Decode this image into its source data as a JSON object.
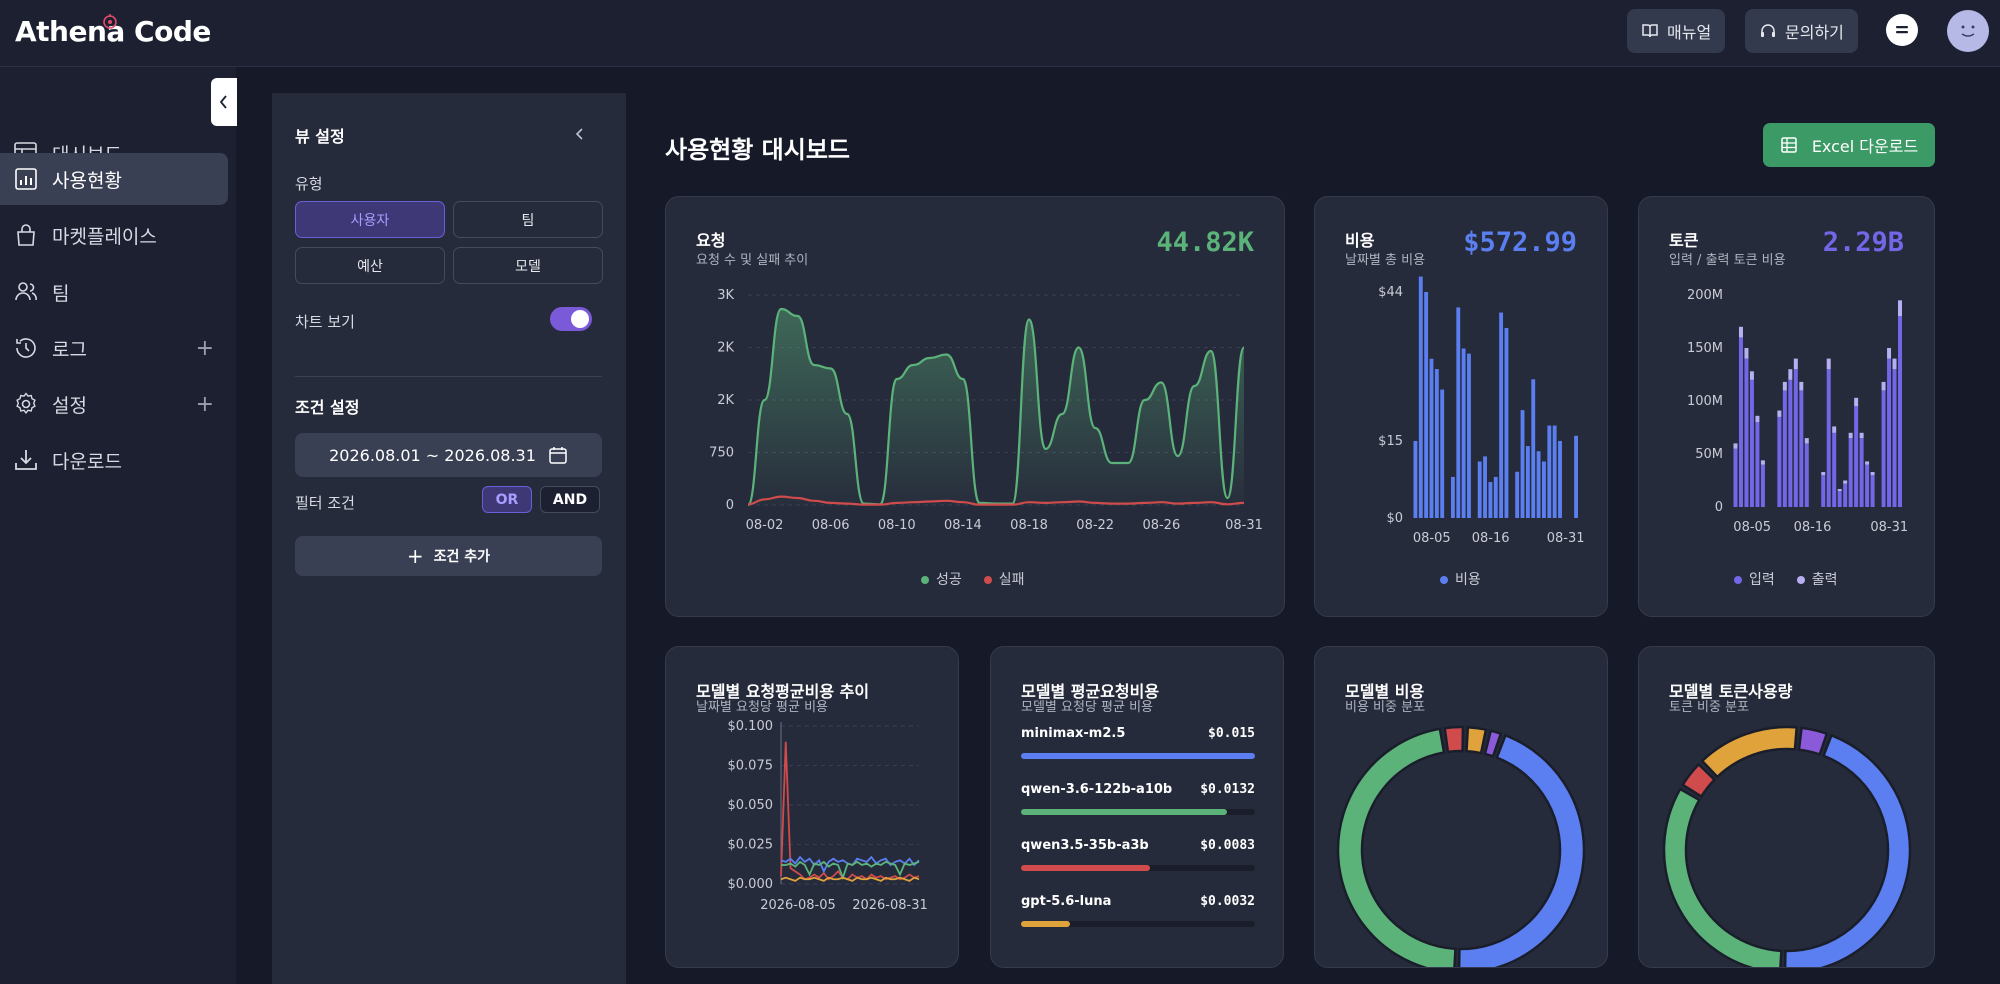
{
  "app": {
    "title": "Athena Code"
  },
  "header": {
    "manual_label": "매뉴얼",
    "contact_label": "문의하기"
  },
  "sidebar": {
    "items": [
      {
        "label": "대시보드",
        "icon": "table-icon"
      },
      {
        "label": "사용현황",
        "icon": "bar-chart-icon",
        "active": true
      },
      {
        "label": "마켓플레이스",
        "icon": "bag-icon"
      },
      {
        "label": "팀",
        "icon": "users-icon"
      },
      {
        "label": "로그",
        "icon": "history-icon",
        "expandable": true
      },
      {
        "label": "설정",
        "icon": "gear-icon",
        "expandable": true
      },
      {
        "label": "다운로드",
        "icon": "download-icon"
      }
    ]
  },
  "view_panel": {
    "title": "뷰 설정",
    "type_label": "유형",
    "type_options": [
      "사용자",
      "팀",
      "예산",
      "모델"
    ],
    "type_selected": "사용자",
    "chart_view_label": "차트 보기",
    "chart_view_on": true,
    "condition_title": "조건 설정",
    "date_range": "2026.08.01 ~ 2026.08.31",
    "filter_label": "필터 조건",
    "filter_or": "OR",
    "filter_and": "AND",
    "filter_selected": "OR",
    "add_condition_label": "조건 추가"
  },
  "main": {
    "title": "사용현황 대시보드",
    "excel_label": "Excel 다운로드"
  },
  "cards": {
    "requests": {
      "title": "요청",
      "subtitle": "요청 수 및 실패 추이",
      "total": "44.82K",
      "legend": [
        "성공",
        "실패"
      ]
    },
    "cost": {
      "title": "비용",
      "subtitle": "날짜별 총 비용",
      "total": "$572.99",
      "legend": [
        "비용"
      ]
    },
    "tokens": {
      "title": "토큰",
      "subtitle": "입력 / 출력 토큰 비용",
      "total": "2.29B",
      "legend": [
        "입력",
        "출력"
      ]
    },
    "model_trend": {
      "title": "모델별 요청평균비용 추이",
      "subtitle": "날짜별 요청당 평균 비용"
    },
    "model_avg": {
      "title": "모델별 평균요청비용",
      "subtitle": "모델별 요청당 평균 비용",
      "rows": [
        {
          "name": "minimax-m2.5",
          "value": "$0.015",
          "ratio": 1.0,
          "color": "#5b7ff0"
        },
        {
          "name": "qwen-3.6-122b-a10b",
          "value": "$0.0132",
          "ratio": 0.88,
          "color": "#5cb37a"
        },
        {
          "name": "qwen3.5-35b-a3b",
          "value": "$0.0083",
          "ratio": 0.55,
          "color": "#d04b4b"
        },
        {
          "name": "gpt-5.6-luna",
          "value": "$0.0032",
          "ratio": 0.21,
          "color": "#e0a23a"
        }
      ]
    },
    "model_cost": {
      "title": "모델별 비용",
      "subtitle": "비용 비중 분포"
    },
    "model_tokens": {
      "title": "모델별 토큰사용량",
      "subtitle": "토큰 비중 분포"
    }
  },
  "colors": {
    "accent": "#7a5ad8",
    "success": "#5cb37a",
    "fail": "#d04b4b",
    "blue": "#5b7ff0",
    "violet": "#7367e8",
    "orange": "#e0a23a",
    "excel": "#3c9a66"
  },
  "chart_data": [
    {
      "type": "area",
      "title": "요청",
      "x_ticks": [
        "08-02",
        "08-06",
        "08-10",
        "08-14",
        "08-18",
        "08-22",
        "08-26",
        "08-31"
      ],
      "y_ticks": [
        "0",
        "750",
        "2K",
        "2K",
        "3K"
      ],
      "ylim": [
        0,
        3000
      ],
      "x": [
        1,
        2,
        3,
        4,
        5,
        6,
        7,
        8,
        9,
        10,
        11,
        12,
        13,
        14,
        15,
        16,
        17,
        18,
        19,
        20,
        21,
        22,
        23,
        24,
        25,
        26,
        27,
        28,
        29,
        30,
        31
      ],
      "series": [
        {
          "name": "성공",
          "values": [
            0,
            1500,
            2800,
            2700,
            2000,
            1950,
            1300,
            20,
            10,
            1800,
            2000,
            2100,
            2150,
            1800,
            30,
            20,
            20,
            2650,
            800,
            1300,
            2250,
            1100,
            600,
            600,
            1500,
            1750,
            700,
            1700,
            2200,
            100,
            2250
          ]
        },
        {
          "name": "실패",
          "values": [
            10,
            80,
            120,
            100,
            60,
            30,
            20,
            5,
            5,
            30,
            40,
            50,
            60,
            40,
            5,
            5,
            5,
            40,
            30,
            40,
            50,
            30,
            20,
            20,
            30,
            40,
            20,
            30,
            40,
            10,
            30
          ]
        }
      ]
    },
    {
      "type": "bar",
      "title": "비용",
      "x_ticks": [
        "08-05",
        "08-16",
        "08-31"
      ],
      "y_ticks": [
        "$0",
        "$15",
        "$44"
      ],
      "ylim": [
        0,
        44
      ],
      "series": [
        {
          "name": "비용",
          "values": [
            15,
            47,
            44,
            31,
            29,
            25,
            0,
            8,
            41,
            33,
            32,
            0,
            11,
            12,
            7,
            8,
            40,
            37,
            0,
            9,
            21,
            14,
            27,
            13,
            11,
            18,
            18,
            15,
            0,
            0,
            16
          ]
        }
      ]
    },
    {
      "type": "bar",
      "title": "토큰",
      "x_ticks": [
        "08-05",
        "08-16",
        "08-31"
      ],
      "y_ticks": [
        "0",
        "50M",
        "100M",
        "150M",
        "200M"
      ],
      "ylim": [
        0,
        200
      ],
      "series": [
        {
          "name": "입력",
          "values": [
            55,
            160,
            140,
            120,
            80,
            40,
            0,
            0,
            85,
            110,
            120,
            130,
            110,
            60,
            0,
            0,
            30,
            130,
            70,
            15,
            22,
            65,
            95,
            65,
            40,
            30,
            0,
            110,
            140,
            130,
            180
          ]
        },
        {
          "name": "출력",
          "values": [
            5,
            10,
            10,
            8,
            6,
            4,
            0,
            0,
            6,
            8,
            10,
            10,
            8,
            5,
            0,
            0,
            3,
            10,
            6,
            2,
            3,
            5,
            8,
            5,
            3,
            3,
            0,
            8,
            10,
            10,
            15
          ]
        }
      ]
    },
    {
      "type": "line",
      "title": "모델별 요청평균비용 추이",
      "x_ticks": [
        "2026-08-05",
        "2026-08-31"
      ],
      "y_ticks": [
        "$0.000",
        "$0.025",
        "$0.050",
        "$0.075",
        "$0.100"
      ],
      "ylim": [
        0,
        0.1
      ],
      "series": [
        {
          "values": [
            0.005,
            0.09,
            0.01,
            0.008,
            0.006,
            0.003,
            0.004,
            0.006,
            0.004,
            0.007,
            0.003,
            0.005,
            0.008,
            0.004,
            0.003,
            0.006,
            0.004,
            0.005,
            0.003,
            0.006,
            0.004,
            0.005,
            0.003,
            0.004,
            0.005,
            0.003,
            0.004,
            0.006,
            0.004,
            0.005
          ]
        },
        {
          "values": [
            0.015,
            0.014,
            0.016,
            0.013,
            0.017,
            0.014,
            0.016,
            0.012,
            0.015,
            0.008,
            0.014,
            0.016,
            0.014,
            0.015,
            0.013,
            0.012,
            0.016,
            0.015,
            0.014,
            0.017,
            0.013,
            0.015,
            0.016,
            0.012,
            0.014,
            0.015,
            0.013,
            0.016,
            0.012,
            0.015
          ]
        },
        {
          "values": [
            0.012,
            0.012,
            0.013,
            0.011,
            0.014,
            0.012,
            0.006,
            0.013,
            0.012,
            0.014,
            0.011,
            0.013,
            0.012,
            0.004,
            0.013,
            0.012,
            0.014,
            0.012,
            0.013,
            0.011,
            0.013,
            0.012,
            0.014,
            0.013,
            0.012,
            0.006,
            0.013,
            0.012,
            0.013,
            0.014
          ]
        },
        {
          "values": [
            0.003,
            0.004,
            0.003,
            0.002,
            0.004,
            0.003,
            0.003,
            0.004,
            0.003,
            0.002,
            0.004,
            0.003,
            0.003,
            0.004,
            0.003,
            0.002,
            0.004,
            0.003,
            0.003,
            0.004,
            0.003,
            0.002,
            0.004,
            0.003,
            0.003,
            0.004,
            0.003,
            0.002,
            0.004,
            0.003
          ]
        }
      ]
    },
    {
      "type": "pie",
      "title": "모델별 비용",
      "values": [
        45,
        47,
        3,
        3,
        2
      ]
    },
    {
      "type": "pie",
      "title": "모델별 토큰사용량",
      "values": [
        45,
        33,
        4,
        14,
        4
      ]
    }
  ]
}
